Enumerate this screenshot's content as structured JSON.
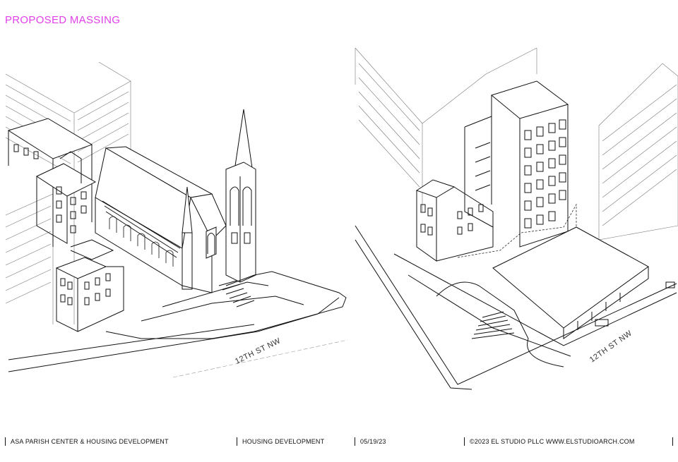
{
  "page": {
    "title": "PROPOSED MASSING",
    "accent_color": "#e040e8"
  },
  "drawings": {
    "existing": {
      "street_label": "12TH ST NW"
    },
    "proposed": {
      "street_label": "12TH ST NW"
    }
  },
  "footer": {
    "project": "ASA PARISH CENTER & HOUSING DEVELOPMENT",
    "section": "HOUSING DEVELOPMENT",
    "date": "05/19/23",
    "copyright": "©2023 EL STUDIO PLLC WWW.ELSTUDIOARCH.COM"
  }
}
